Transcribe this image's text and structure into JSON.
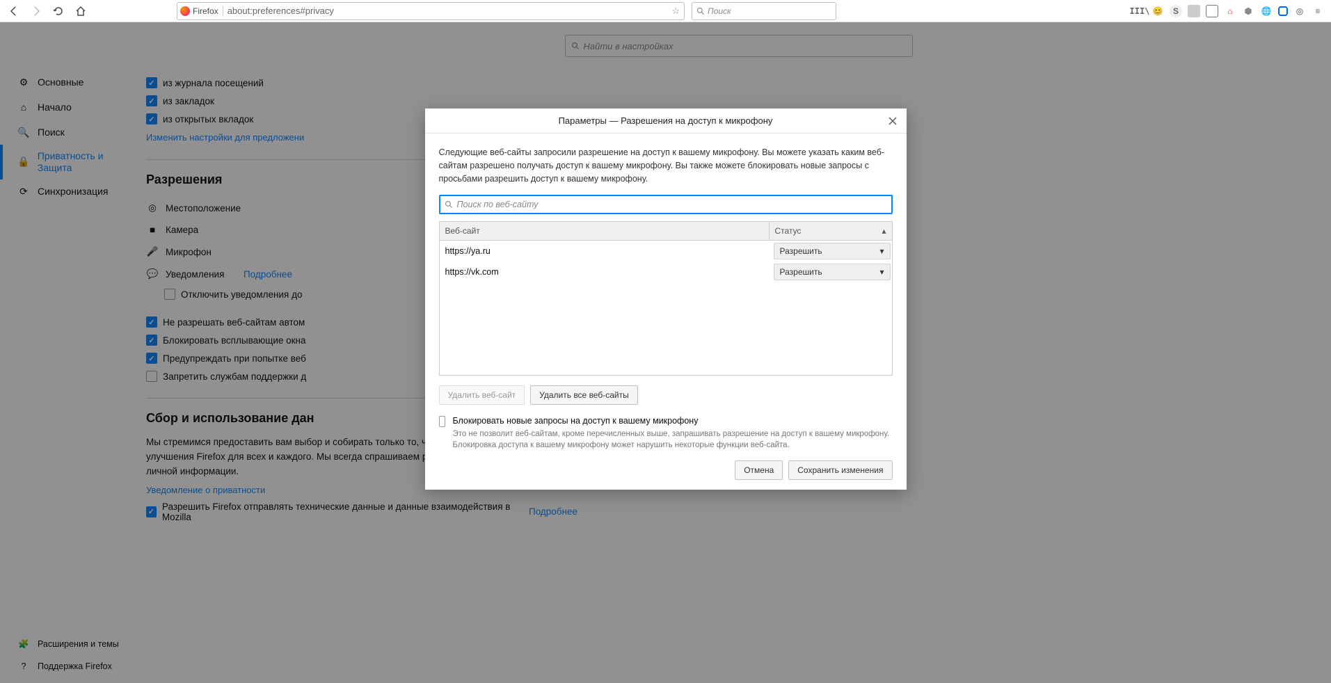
{
  "toolbar": {
    "identity_label": "Firefox",
    "url": "about:preferences#privacy",
    "search_placeholder": "Поиск"
  },
  "sidebar": {
    "items": [
      {
        "label": "Основные"
      },
      {
        "label": "Начало"
      },
      {
        "label": "Поиск"
      },
      {
        "label": "Приватность и Защита"
      },
      {
        "label": "Синхронизация"
      }
    ],
    "bottom": [
      {
        "label": "Расширения и темы"
      },
      {
        "label": "Поддержка Firefox"
      }
    ]
  },
  "searchPrefs": {
    "placeholder": "Найти в настройках"
  },
  "addressBar": {
    "opt_history": "из журнала посещений",
    "opt_bookmarks": "из закладок",
    "opt_opentabs": "из открытых вкладок",
    "change_link": "Изменить настройки для предложени"
  },
  "permissions": {
    "heading": "Разрешения",
    "location": "Местоположение",
    "camera": "Камера",
    "microphone": "Микрофон",
    "notifications": "Уведомления",
    "notifications_more": "Подробнее",
    "notifications_disable": "Отключить уведомления до",
    "no_auto": "Не разрешать веб-сайтам автом",
    "block_popups": "Блокировать всплывающие окна",
    "warn_install": "Предупреждать при попытке веб",
    "deny_support": "Запретить службам поддержки д"
  },
  "dataCollection": {
    "heading": "Сбор и использование дан",
    "para": "Мы стремимся предоставить вам выбор и собирать только то, что нам нужно, для выпуска и улучшения Firefox для всех и каждого. Мы всегда спрашиваем разрешения перед получением личной информации.",
    "privacy_link": "Уведомление о приватности",
    "telemetry": "Разрешить Firefox отправлять технические данные и данные взаимодействия в Mozilla",
    "telemetry_more": "Подробнее"
  },
  "dialog": {
    "title": "Параметры — Разрешения на доступ к микрофону",
    "desc": "Следующие веб-сайты запросили разрешение на доступ к вашему микрофону. Вы можете указать каким веб-сайтам разрешено получать доступ к вашему микрофону. Вы также можете блокировать новые запросы с просьбами разрешить доступ к вашему микрофону.",
    "search_placeholder": "Поиск по веб-сайту",
    "col_site": "Веб-сайт",
    "col_status": "Статус",
    "rows": [
      {
        "site": "https://ya.ru",
        "status": "Разрешить"
      },
      {
        "site": "https://vk.com",
        "status": "Разрешить"
      }
    ],
    "remove_site": "Удалить веб-сайт",
    "remove_all": "Удалить все веб-сайты",
    "block_new_label": "Блокировать новые запросы на доступ к вашему микрофону",
    "block_new_desc": "Это не позволит веб-сайтам, кроме перечисленных выше, запрашивать разрешение на доступ к вашему микрофону. Блокировка доступа к вашему микрофону может нарушить некоторые функции веб-сайта.",
    "cancel": "Отмена",
    "save": "Сохранить изменения"
  }
}
